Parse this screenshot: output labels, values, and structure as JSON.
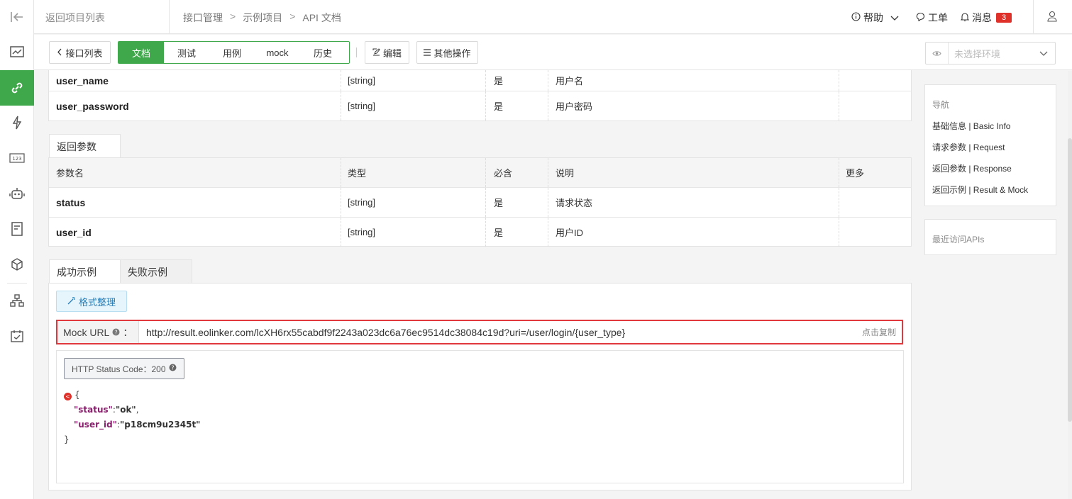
{
  "header": {
    "back_label": "返回项目列表",
    "breadcrumb": [
      "接口管理",
      "示例项目",
      "API 文档"
    ],
    "help": "帮助",
    "ticket": "工单",
    "messages": "消息",
    "message_count": "3"
  },
  "toolbar": {
    "api_list": "接口列表",
    "tabs": [
      "文档",
      "测试",
      "用例",
      "mock",
      "历史"
    ],
    "edit": "编辑",
    "more": "其他操作",
    "env_placeholder": "未选择环境"
  },
  "request_rows": [
    {
      "name": "user_name",
      "type": "[string]",
      "required": "是",
      "desc": "用户名"
    },
    {
      "name": "user_password",
      "type": "[string]",
      "required": "是",
      "desc": "用户密码"
    }
  ],
  "response": {
    "tab": "返回参数",
    "headers": [
      "参数名",
      "类型",
      "必含",
      "说明",
      "更多"
    ],
    "rows": [
      {
        "name": "status",
        "type": "[string]",
        "required": "是",
        "desc": "请求状态"
      },
      {
        "name": "user_id",
        "type": "[string]",
        "required": "是",
        "desc": "用户ID"
      }
    ]
  },
  "examples": {
    "tabs": [
      "成功示例",
      "失败示例"
    ],
    "format_btn": "格式整理",
    "mock_label": "Mock URL",
    "mock_colon": "：",
    "mock_url": "http://result.eolinker.com/lcXH6rx55cabdf9f2243a023dc6a76ec9514dc38084c19d?uri=/user/login/{user_type}",
    "copy": "点击复制",
    "status_code": "HTTP Status Code：200",
    "json": {
      "open": "{",
      "k1": "\"status\"",
      "v1": "\"ok\"",
      "k2": "\"user_id\"",
      "v2": "\"p18cm9u2345t\"",
      "close": "}"
    }
  },
  "right_nav": {
    "title": "导航",
    "items": [
      "基础信息 | Basic Info",
      "请求参数 | Request",
      "返回参数 | Response",
      "返回示例 | Result & Mock"
    ],
    "recent": "最近访问APIs"
  }
}
